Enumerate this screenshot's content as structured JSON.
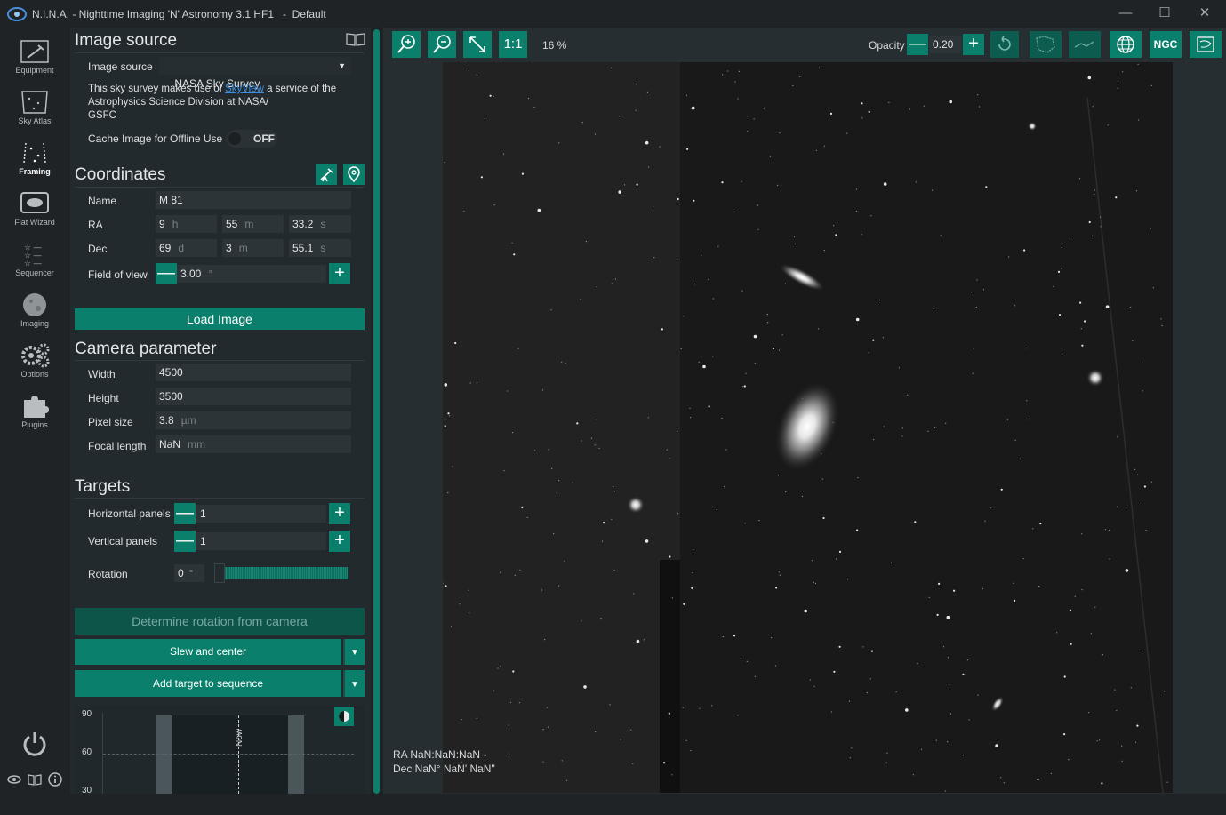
{
  "window": {
    "title": "N.I.N.A. - Nighttime Imaging 'N' Astronomy 3.1 HF1   -  Default",
    "minimize": "—",
    "maximize": "☐",
    "close": "✕"
  },
  "nav": [
    {
      "label": "Equipment",
      "icon": "telescope-icon"
    },
    {
      "label": "Sky Atlas",
      "icon": "star-map-icon"
    },
    {
      "label": "Framing",
      "icon": "framing-icon",
      "active": true
    },
    {
      "label": "Flat Wizard",
      "icon": "flat-panel-icon"
    },
    {
      "label": "Sequencer",
      "icon": "sequencer-icon"
    },
    {
      "label": "Imaging",
      "icon": "imaging-icon"
    },
    {
      "label": "Options",
      "icon": "gears-icon"
    },
    {
      "label": "Plugins",
      "icon": "puzzle-icon"
    }
  ],
  "nav_footer": {
    "collapse": "< <"
  },
  "image_source": {
    "header": "Image source",
    "label": "Image source",
    "value": "NASA Sky Survey",
    "note_prefix": "This sky survey makes use of ",
    "note_link": "SkyView",
    "note_rest": " a service of the Astrophysics Science Division at NASA/\nGSFC",
    "cache_label": "Cache Image for Offline Use",
    "cache_state": "OFF"
  },
  "coordinates": {
    "header": "Coordinates",
    "name_label": "Name",
    "name_value": "M 81",
    "ra_label": "RA",
    "ra_h": "9",
    "ra_h_unit": "h",
    "ra_m": "55",
    "ra_m_unit": "m",
    "ra_s": "33.2",
    "ra_s_unit": "s",
    "dec_label": "Dec",
    "dec_d": "69",
    "dec_d_unit": "d",
    "dec_m": "3",
    "dec_m_unit": "m",
    "dec_s": "55.1",
    "dec_s_unit": "s",
    "fov_label": "Field of view",
    "fov_value": "3.00",
    "fov_unit": "°",
    "load_button": "Load Image"
  },
  "camera": {
    "header": "Camera parameter",
    "width_label": "Width",
    "width_value": "4500",
    "height_label": "Height",
    "height_value": "3500",
    "pixel_label": "Pixel size",
    "pixel_value": "3.8",
    "pixel_unit": "µm",
    "focal_label": "Focal length",
    "focal_value": "NaN",
    "focal_unit": "mm"
  },
  "targets": {
    "header": "Targets",
    "hpanels_label": "Horizontal panels",
    "hpanels_value": "1",
    "vpanels_label": "Vertical panels",
    "vpanels_value": "1",
    "rotation_label": "Rotation",
    "rotation_value": "0",
    "rotation_unit": "°",
    "rotation_level": 0,
    "determine_button": "Determine rotation from camera",
    "slew_button": "Slew and center",
    "add_button": "Add target to sequence"
  },
  "altitude": {
    "y90": "90",
    "y60": "60",
    "y30": "30",
    "now": "Now"
  },
  "toolbar": {
    "one_to_one": "1:1",
    "zoom": "16 %",
    "opacity_label": "Opacity",
    "opacity_value": "0.20",
    "ngc": "NGC"
  },
  "image_coords": {
    "ra": "RA  NaN:NaN:NaN",
    "dec": "Dec  NaN° NaN' NaN\""
  },
  "colors": {
    "accent": "#0a7f6b",
    "background": "#1f2326",
    "panel": "#222a2d"
  }
}
